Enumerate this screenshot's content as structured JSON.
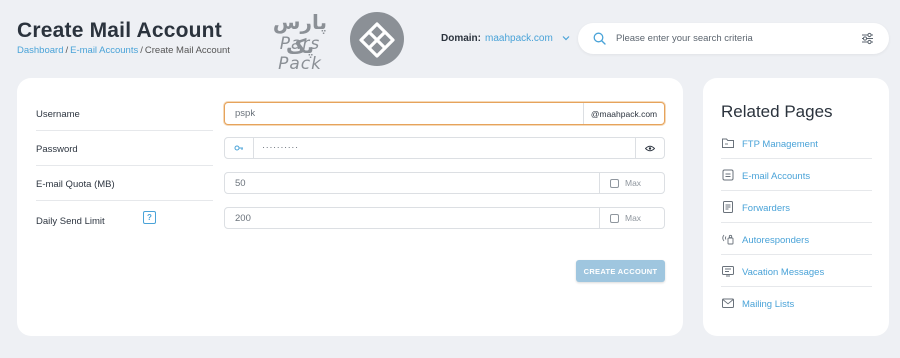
{
  "header": {
    "title": "Create Mail Account",
    "breadcrumb": [
      "Dashboard",
      "E-mail Accounts",
      "Create Mail Account"
    ],
    "domain_label": "Domain:",
    "domain_value": "maahpack.com"
  },
  "logo": {
    "text_fa": "پارس پک",
    "text_en": "Pars Pack"
  },
  "search": {
    "placeholder": "Please enter your search criteria"
  },
  "form": {
    "username": {
      "label": "Username",
      "value": "pspk",
      "suffix": "@maahpack.com"
    },
    "password": {
      "label": "Password",
      "value": "··········"
    },
    "quota": {
      "label": "E-mail Quota (MB)",
      "value": "50",
      "max_label": "Max"
    },
    "send_limit": {
      "label": "Daily Send Limit",
      "help": "?",
      "value": "200",
      "max_label": "Max"
    },
    "submit_label": "CREATE ACCOUNT"
  },
  "related": {
    "title": "Related Pages",
    "items": [
      {
        "label": "FTP Management",
        "icon": "folder-icon"
      },
      {
        "label": "E-mail Accounts",
        "icon": "mail-list-icon"
      },
      {
        "label": "Forwarders",
        "icon": "forward-doc-icon"
      },
      {
        "label": "Autoresponders",
        "icon": "broadcast-icon"
      },
      {
        "label": "Vacation Messages",
        "icon": "vacation-message-icon"
      },
      {
        "label": "Mailing Lists",
        "icon": "envelope-icon"
      }
    ]
  },
  "colors": {
    "accent": "#4aa3d8",
    "focus_border": "#e6a35c",
    "button": "#9fc6df",
    "background": "#eef0f4"
  }
}
